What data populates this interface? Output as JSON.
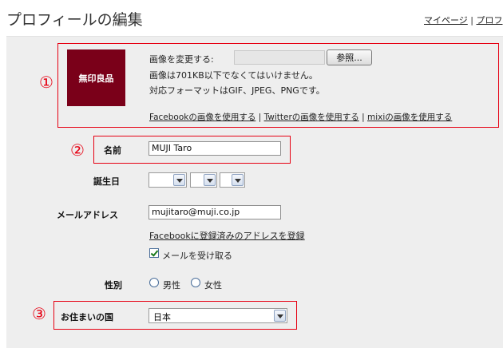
{
  "page": {
    "title": "プロフィールの編集",
    "links": {
      "mypage": "マイページ",
      "separator": "|",
      "profile": "プロフ"
    }
  },
  "markers": {
    "m1": "①",
    "m2": "②",
    "m3": "③"
  },
  "image_section": {
    "logo_text": "無印良品",
    "change_label": "画像を変更する:",
    "browse_button": "参照...",
    "size_note": "画像は701KB以下でなくてはいけません。",
    "format_note": "対応フォーマットはGIF、JPEG、PNGです。",
    "facebook_link": "Facebookの画像を使用する",
    "twitter_link": "Twitterの画像を使用する",
    "mixi_link": "mixiの画像を使用する",
    "sep": "|"
  },
  "form": {
    "name_label": "名前",
    "name_value": "MUJI Taro",
    "birthday_label": "誕生日",
    "email_label": "メールアドレス",
    "email_value": "mujitaro@muji.co.jp",
    "facebook_email_link": "Facebookに登録済みのアドレスを登録",
    "receive_mail_label": "メールを受け取る",
    "receive_mail_checked": true,
    "gender_label": "性別",
    "gender_male": "男性",
    "gender_female": "女性",
    "country_label": "お住まいの国",
    "country_value": "日本"
  },
  "colors": {
    "accent_red": "#e60012",
    "logo_bg": "#7a0019",
    "panel_bg": "#eeeeee"
  }
}
